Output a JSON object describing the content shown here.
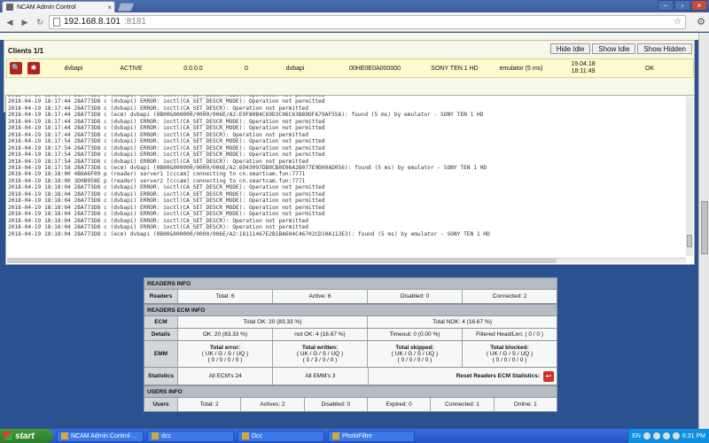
{
  "browser": {
    "tab_title": "NCAM Admin Control",
    "tab_close": "×",
    "url_host": "192.168.8.101",
    "url_port": ":8181"
  },
  "clients": {
    "title": "Clients 1/1",
    "buttons": [
      "Hide Idle",
      "Show Idle",
      "Show Hidden"
    ],
    "row": {
      "protocol": "dvbapi",
      "status": "ACTIVE",
      "ip": "0.0.0.0",
      "port": "0",
      "reader": "dvbapi",
      "caid": "00HE0E0A000000",
      "channel": "SONY TEN 1 HD",
      "source": "emulator (5 ms)",
      "date": "19.04.18",
      "time": "18:11:49",
      "ecm": "OK"
    }
  },
  "log_lines": [
    "2018-04-19 18:17:44 28A773D8 c (dvbapi) ERROR: ioctl(CA_SET_DESCR_MODE): Operation not permitted",
    "2018-04-19 18:17:44 28A773D8 c (dvbapi) ERROR: ioctl(CA_SET_DESCR_MODE): Operation not permitted",
    "2018-04-19 18:17:44 28A773D8 c (dvbapi) ERROR: ioctl(CA_SET_DESCR): Operation not permitted",
    "2018-04-19 18:17:44 28A773D8 c (ecm) dvbapi (0B00&000000/0000/006E/A2:E9F80B4C69D3C06C63B89DFA79AF55A): found (5 ms) by emulator - SONY TEN 1 HD",
    "2018-04-19 18:17:44 28A773D8 c (dvbapi) ERROR: ioctl(CA_SET_DESCR_MODE): Operation not permitted",
    "2018-04-19 18:17:44 28A773D8 c (dvbapi) ERROR: ioctl(CA_SET_DESCR_MODE): Operation not permitted",
    "2018-04-19 18:17:44 28A773D8 c (dvbapi) ERROR: ioctl(CA_SET_DESCR): Operation not permitted",
    "2018-04-19 18:17:54 28A773D8 c (dvbapi) ERROR: ioctl(CA_SET_DESCR_MODE): Operation not permitted",
    "2018-04-19 18:17:54 28A773D8 c (dvbapi) ERROR: ioctl(CA_SET_DESCR_MODE): Operation not permitted",
    "2018-04-19 18:17:54 28A773D8 c (dvbapi) ERROR: ioctl(CA_SET_DESCR_MODE): Operation not permitted",
    "2018-04-19 18:17:54 28A773D8 c (dvbapi) ERROR: ioctl(CA_SET_DESCR): Operation not permitted",
    "2018-04-19 18:17:58 28A773D8 c (ecm) dvbapi (0B00&000000/0000/006E/A2:6943097DB9CB0E06A2B077E9D00AD056): found (5 ms) by emulator - SONY TEN 1 HD",
    "2018-04-19 18:18:00 4B6A6F09 p (reader) server1 [cccam] connecting to cn.smartcam.fun:7771",
    "2018-04-19 18:18:00 3D0B958E p (reader) server2 [cccam] connecting to cn.smartcam.fun:7771",
    "2018-04-19 18:18:04 28A773D8 c (dvbapi) ERROR: ioctl(CA_SET_DESCR_MODE): Operation not permitted",
    "2018-04-19 18:18:04 28A773D8 c (dvbapi) ERROR: ioctl(CA_SET_DESCR_MODE): Operation not permitted",
    "2018-04-19 18:18:04 28A773D8 c (dvbapi) ERROR: ioctl(CA_SET_DESCR_MODE): Operation not permitted",
    "2018-04-19 18:18:04 28A773D8 c (dvbapi) ERROR: ioctl(CA_SET_DESCR_MODE): Operation not permitted",
    "2018-04-19 18:18:04 28A773D8 c (dvbapi) ERROR: ioctl(CA_SET_DESCR_MODE): Operation not permitted",
    "2018-04-19 18:18:04 28A773D8 c (dvbapi) ERROR: ioctl(CA_SET_DESCR): Operation not permitted",
    "2018-04-19 18:18:04 28A773D8 c (dvbapi) ERROR: ioctl(CA_SET_DESCR): Operation not permitted",
    "2018-04-19 18:18:04 28A773D8 c (ecm) dvbapi (0B00&000000/0000/006E/A2:18111467E2B1BA604C46702CD10A113E3): found (5 ms) by emulator - SONY TEN 1 HD"
  ],
  "readers_info": {
    "header": "READERS INFO",
    "label": "Readers",
    "total": "Total: 6",
    "active": "Active: 6",
    "disabled": "Disabled: 0",
    "connected": "Connected: 2"
  },
  "readers_ecm": {
    "header": "READERS ECM INFO",
    "ecm_label": "ECM",
    "total_ok": "Total OK: 20 (83.33 %)",
    "total_nok": "Total NOK: 4 (16.67 %)",
    "details_label": "Details",
    "ok": "OK: 20 (83.33 %)",
    "not_ok": "not OK: 4 (16.67 %)",
    "timeout": "Timeout: 0 (0.00 %)",
    "filtered": "Filtered Head/Len: ( 0 / 0 )",
    "emm_label": "EMM",
    "emm": [
      {
        "title": "Total error:",
        "sub": "( UK / G / S / UQ )",
        "vals": "( 0 / 0 / 0 / 0 )"
      },
      {
        "title": "Total written:",
        "sub": "( UK / G / S / UQ )",
        "vals": "( 0 / 3 / 0 / 0 )"
      },
      {
        "title": "Total skipped:",
        "sub": "( UK / G / S / UQ )",
        "vals": "( 0 / 0 / 0 / 0 )"
      },
      {
        "title": "Total blocked:",
        "sub": "( UK / G / S / UQ )",
        "vals": "( 0 / 0 / 0 / 0 )"
      }
    ],
    "stats_label": "Statistics",
    "all_ecm": "All ECM's 24",
    "all_emm": "All EMM's 3",
    "reset": "Reset Readers ECM Statistics:",
    "reset_icon": "↩"
  },
  "users_info": {
    "header": "USERS INFO",
    "label": "Users",
    "total": "Total: 2",
    "actives": "Actives: 2",
    "disabled": "Disabled: 0",
    "expired": "Expired: 0",
    "connected": "Connected: 1",
    "online": "Online: 1"
  },
  "taskbar": {
    "start": "start",
    "tasks": [
      "NCAM Admin Control ...",
      "dcc",
      "Dcc",
      "PhotoFiltre"
    ],
    "lang": "EN",
    "clock": "6:31 PM"
  }
}
